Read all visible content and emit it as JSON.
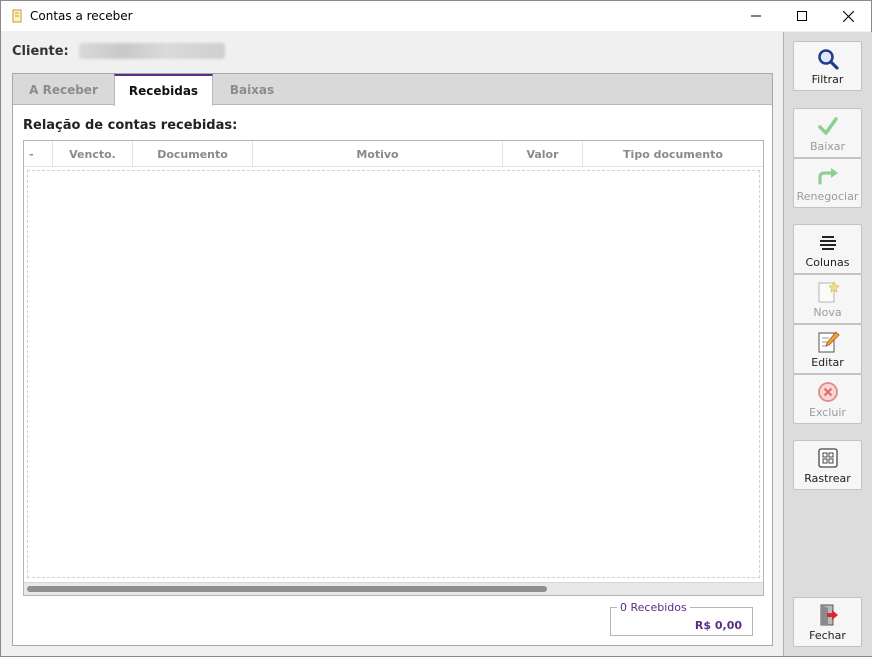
{
  "window": {
    "title": "Contas a receber"
  },
  "client": {
    "label": "Cliente:"
  },
  "tabs": [
    {
      "label": "A Receber"
    },
    {
      "label": "Recebidas"
    },
    {
      "label": "Baixas"
    }
  ],
  "section": {
    "title": "Relação de contas recebidas:"
  },
  "grid": {
    "columns": [
      "-",
      "Vencto.",
      "Documento",
      "Motivo",
      "Valor",
      "Tipo documento"
    ],
    "rows": []
  },
  "summary": {
    "count_label": "0 Recebidos",
    "total": "R$ 0,00"
  },
  "toolbar": {
    "filtrar": "Filtrar",
    "baixar": "Baixar",
    "renegociar": "Renegociar",
    "colunas": "Colunas",
    "nova": "Nova",
    "editar": "Editar",
    "excluir": "Excluir",
    "rastrear": "Rastrear",
    "fechar": "Fechar"
  },
  "colors": {
    "accent": "#5b2c86",
    "disabled_text": "#9b9b9b"
  }
}
